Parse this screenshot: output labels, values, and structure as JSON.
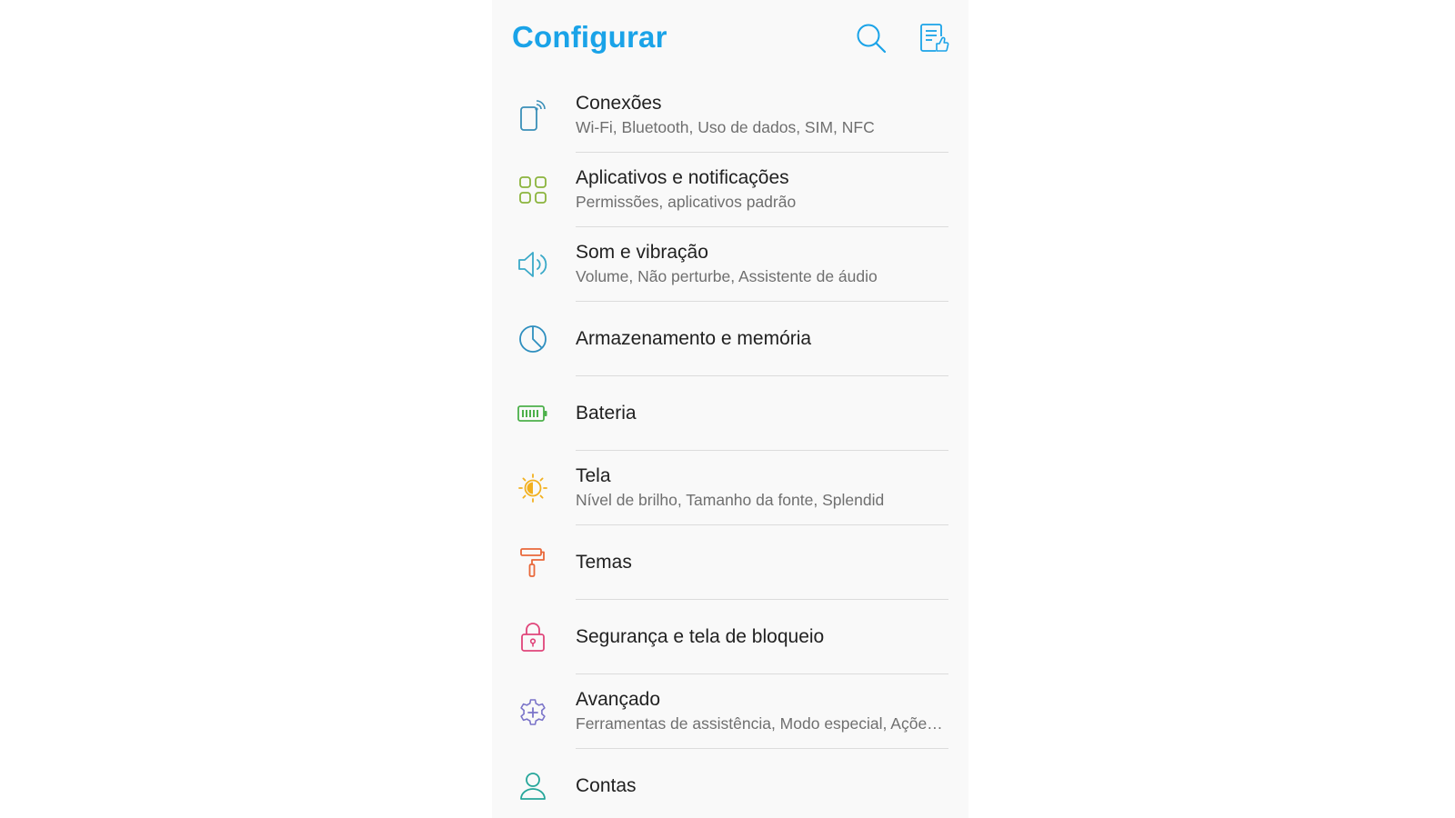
{
  "header": {
    "title": "Configurar",
    "search_icon": "search-icon",
    "feedback_icon": "feedback-icon",
    "accent": "#1aa3e8"
  },
  "items": [
    {
      "label": "Conexões",
      "sub": "Wi-Fi, Bluetooth, Uso de dados, SIM, NFC",
      "icon": "connections-icon",
      "color": "#3a8fb8"
    },
    {
      "label": "Aplicativos e notificações",
      "sub": "Permissões, aplicativos padrão",
      "icon": "apps-grid-icon",
      "color": "#8bb43c"
    },
    {
      "label": "Som e vibração",
      "sub": "Volume, Não perturbe, Assistente de áudio",
      "icon": "speaker-icon",
      "color": "#3aa9c8"
    },
    {
      "label": "Armazenamento e memória",
      "sub": "",
      "icon": "pie-chart-icon",
      "color": "#2f8fbf"
    },
    {
      "label": "Bateria",
      "sub": "",
      "icon": "battery-icon",
      "color": "#4cb04a"
    },
    {
      "label": "Tela",
      "sub": "Nível de brilho, Tamanho da fonte, Splendid",
      "icon": "brightness-icon",
      "color": "#f2b01e"
    },
    {
      "label": "Temas",
      "sub": "",
      "icon": "paint-roller-icon",
      "color": "#e9683a"
    },
    {
      "label": "Segurança e tela de bloqueio",
      "sub": "",
      "icon": "lock-icon",
      "color": "#e0457a"
    },
    {
      "label": "Avançado",
      "sub": "Ferramentas de assistência, Modo especial, Ações rápidas",
      "icon": "gear-plus-icon",
      "color": "#7b74c9"
    },
    {
      "label": "Contas",
      "sub": "",
      "icon": "user-icon",
      "color": "#26a69a"
    }
  ]
}
